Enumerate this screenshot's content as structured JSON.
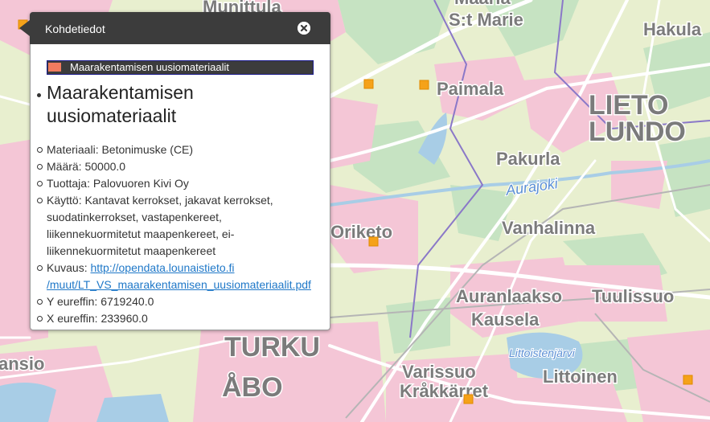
{
  "map": {
    "places": [
      {
        "id": "muntitula",
        "label": "Munittula",
        "size": "sm"
      },
      {
        "id": "maaria",
        "label": "Maaria",
        "size": "sm"
      },
      {
        "id": "st-marie",
        "label": "S:t Marie",
        "size": "sm"
      },
      {
        "id": "hakula",
        "label": "Hakula",
        "size": "sm"
      },
      {
        "id": "paimala",
        "label": "Paimala",
        "size": "sm"
      },
      {
        "id": "lieto",
        "label": "LIETO",
        "size": "lg"
      },
      {
        "id": "lundo",
        "label": "LUNDO",
        "size": "lg"
      },
      {
        "id": "pakurla",
        "label": "Pakurla",
        "size": "sm"
      },
      {
        "id": "oriketo",
        "label": "Oriketo",
        "size": "sm"
      },
      {
        "id": "vanhalinna",
        "label": "Vanhalinna",
        "size": "sm"
      },
      {
        "id": "auranlaakso",
        "label": "Auranlaakso",
        "size": "sm"
      },
      {
        "id": "tuulissuo",
        "label": "Tuulissuo",
        "size": "sm"
      },
      {
        "id": "kausela",
        "label": "Kausela",
        "size": "sm"
      },
      {
        "id": "turku",
        "label": "TURKU",
        "size": "lg"
      },
      {
        "id": "abo",
        "label": "ÅBO",
        "size": "lg"
      },
      {
        "id": "varissuo",
        "label": "Varissuo",
        "size": "sm"
      },
      {
        "id": "krakkarret",
        "label": "Kråkkärret",
        "size": "sm"
      },
      {
        "id": "littoinen",
        "label": "Littoinen",
        "size": "sm"
      },
      {
        "id": "ansio",
        "label": "ansio",
        "size": "sm"
      }
    ],
    "water_labels": [
      {
        "id": "aurajoki",
        "label": "Aurajoki"
      },
      {
        "id": "littoistenjarvi",
        "label": "Littoistenjärvi"
      }
    ],
    "colors": {
      "base": "#e8efcf",
      "urban": "#f4c6d6",
      "forest": "#c6e3c2",
      "water": "#a8cde6",
      "road": "#ffffff",
      "border": "#8a78c8",
      "marker": "#f5a219"
    }
  },
  "popup": {
    "title": "Kohdetiedot",
    "close_icon": "close-circle-icon",
    "layer_name": "Maarakentamisen uusiomateriaalit",
    "layer_color": "#f07b5f",
    "item_title": "Maarakentamisen uusiomateriaalit",
    "attributes": [
      {
        "key": "materiaali",
        "text": "Materiaali: Betonimuske (CE)"
      },
      {
        "key": "maara",
        "text": "Määrä: 50000.0"
      },
      {
        "key": "tuottaja",
        "text": "Tuottaja: Palovuoren Kivi Oy"
      },
      {
        "key": "kaytto",
        "text": "Käyttö: Kantavat kerrokset, jakavat kerrokset, suodatinkerrokset, vastapenkereet, liikennekuormitetut maapenkereet, ei-liikennekuormitetut maapenkereet"
      },
      {
        "key": "y",
        "text": "Y eureffin: 6719240.0"
      },
      {
        "key": "x",
        "text": "X eureffin: 233960.0"
      }
    ],
    "kuvaus_label": "Kuvaus: ",
    "kuvaus_link": "http://opendata.lounaistieto.fi/muut/LT_VS_maarakentamisen_uusiomateriaalit.pdf"
  }
}
